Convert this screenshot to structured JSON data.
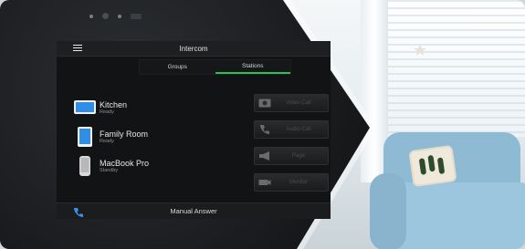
{
  "header": {
    "title": "Intercom"
  },
  "tabs": [
    {
      "label": "Groups",
      "active": false
    },
    {
      "label": "Stations",
      "active": true
    }
  ],
  "devices": [
    {
      "name": "Kitchen",
      "status": "Ready",
      "icon": "monitor-icon"
    },
    {
      "name": "Family Room",
      "status": "Ready",
      "icon": "tablet-icon"
    },
    {
      "name": "MacBook Pro",
      "status": "Standby",
      "icon": "phone-icon"
    }
  ],
  "actions": [
    {
      "label": "Video Call",
      "icon": "video-call-icon"
    },
    {
      "label": "Audio Call",
      "icon": "audio-call-icon"
    },
    {
      "label": "Page",
      "icon": "megaphone-icon"
    },
    {
      "label": "Monitor",
      "icon": "camera-icon"
    }
  ],
  "footer": {
    "label": "Manual Answer"
  },
  "colors": {
    "accent": "#2fbf5a",
    "phone": "#3a8ee6",
    "device": "#3a8ee6"
  }
}
